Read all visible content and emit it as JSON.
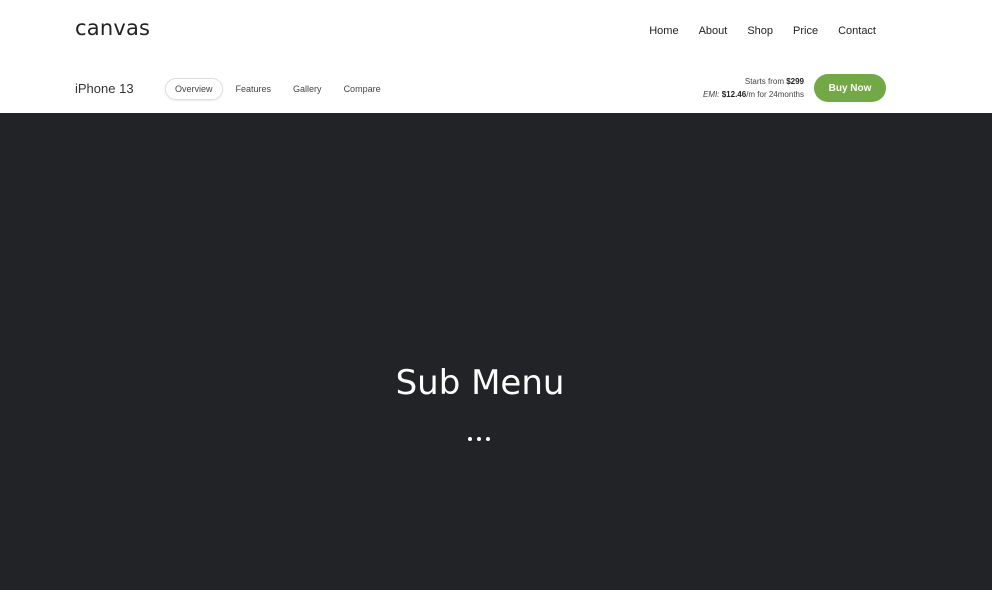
{
  "header": {
    "logo": "canvas",
    "nav": [
      "Home",
      "About",
      "Shop",
      "Price",
      "Contact"
    ]
  },
  "subheader": {
    "product": "iPhone 13",
    "tabs": [
      "Overview",
      "Features",
      "Gallery",
      "Compare"
    ],
    "active_tab": "Overview",
    "price_prefix": "Starts from ",
    "price": "$299",
    "emi_prefix": "EMI: ",
    "emi_amount": "$12.46",
    "emi_suffix": "/m for 24months",
    "buy_label": "Buy Now",
    "accent_color": "#72a845"
  },
  "hero": {
    "title": "Sub Menu",
    "background": "#222327"
  }
}
